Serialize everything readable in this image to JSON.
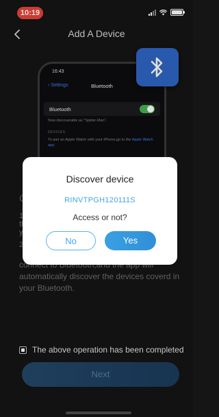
{
  "status_bar": {
    "time": "10:19"
  },
  "nav": {
    "title": "Add A Device"
  },
  "phone": {
    "time": "16:43",
    "back_label": "Settings",
    "screen_title": "Bluetooth",
    "row_label": "Bluetooth",
    "discoverable_note": "Now discoverable as \"Spider-Man\".",
    "devices_header": "DEVICES",
    "watch_note": "To pair an Apple Watch with your iPhone,go to the",
    "watch_link": "Apple Watch app."
  },
  "instructions": {
    "heading_partial": "C",
    "line1_partial": "1",
    "line2_partial": "th",
    "line3_partial": "y",
    "line4_partial": "2",
    "tail": "connect to Bluetooth,and the app will automatically discover the devices coverd in your Bluetooth."
  },
  "dialog": {
    "title": "Discover device",
    "device_id": "RINVTPGH120111S",
    "question": "Access or not?",
    "no_label": "No",
    "yes_label": "Yes"
  },
  "confirm": {
    "label": "The above operation has been completed",
    "checked": true
  },
  "next_label": "Next",
  "colors": {
    "accent": "#3aa0e3",
    "time_pill": "#e8443a",
    "bluetooth_badge": "#2f66c4"
  }
}
